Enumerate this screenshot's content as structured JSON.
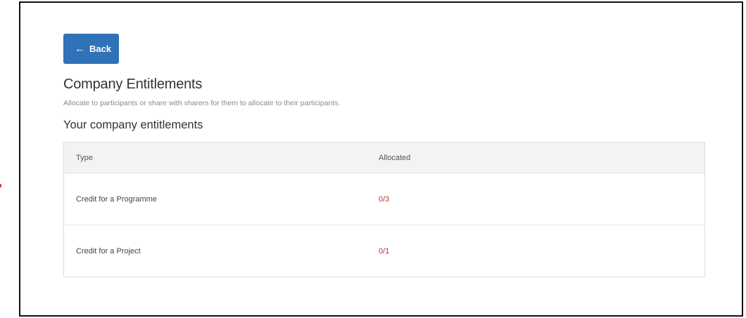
{
  "back_button": {
    "label": "Back",
    "icon": "arrow-left-icon"
  },
  "page": {
    "title": "Company Entitlements",
    "subtitle": "Allocate to participants or share with sharers for them to allocate to their participants.",
    "section_title": "Your company entitlements"
  },
  "table": {
    "columns": [
      "Type",
      "Allocated"
    ],
    "rows": [
      {
        "type": "Credit for a Programme",
        "allocated": "0/3"
      },
      {
        "type": "Credit for a Project",
        "allocated": "0/1"
      }
    ]
  },
  "colors": {
    "accent": "#2f72b8",
    "allocated_text": "#b23a3a",
    "header_bg": "#f3f3f3"
  }
}
